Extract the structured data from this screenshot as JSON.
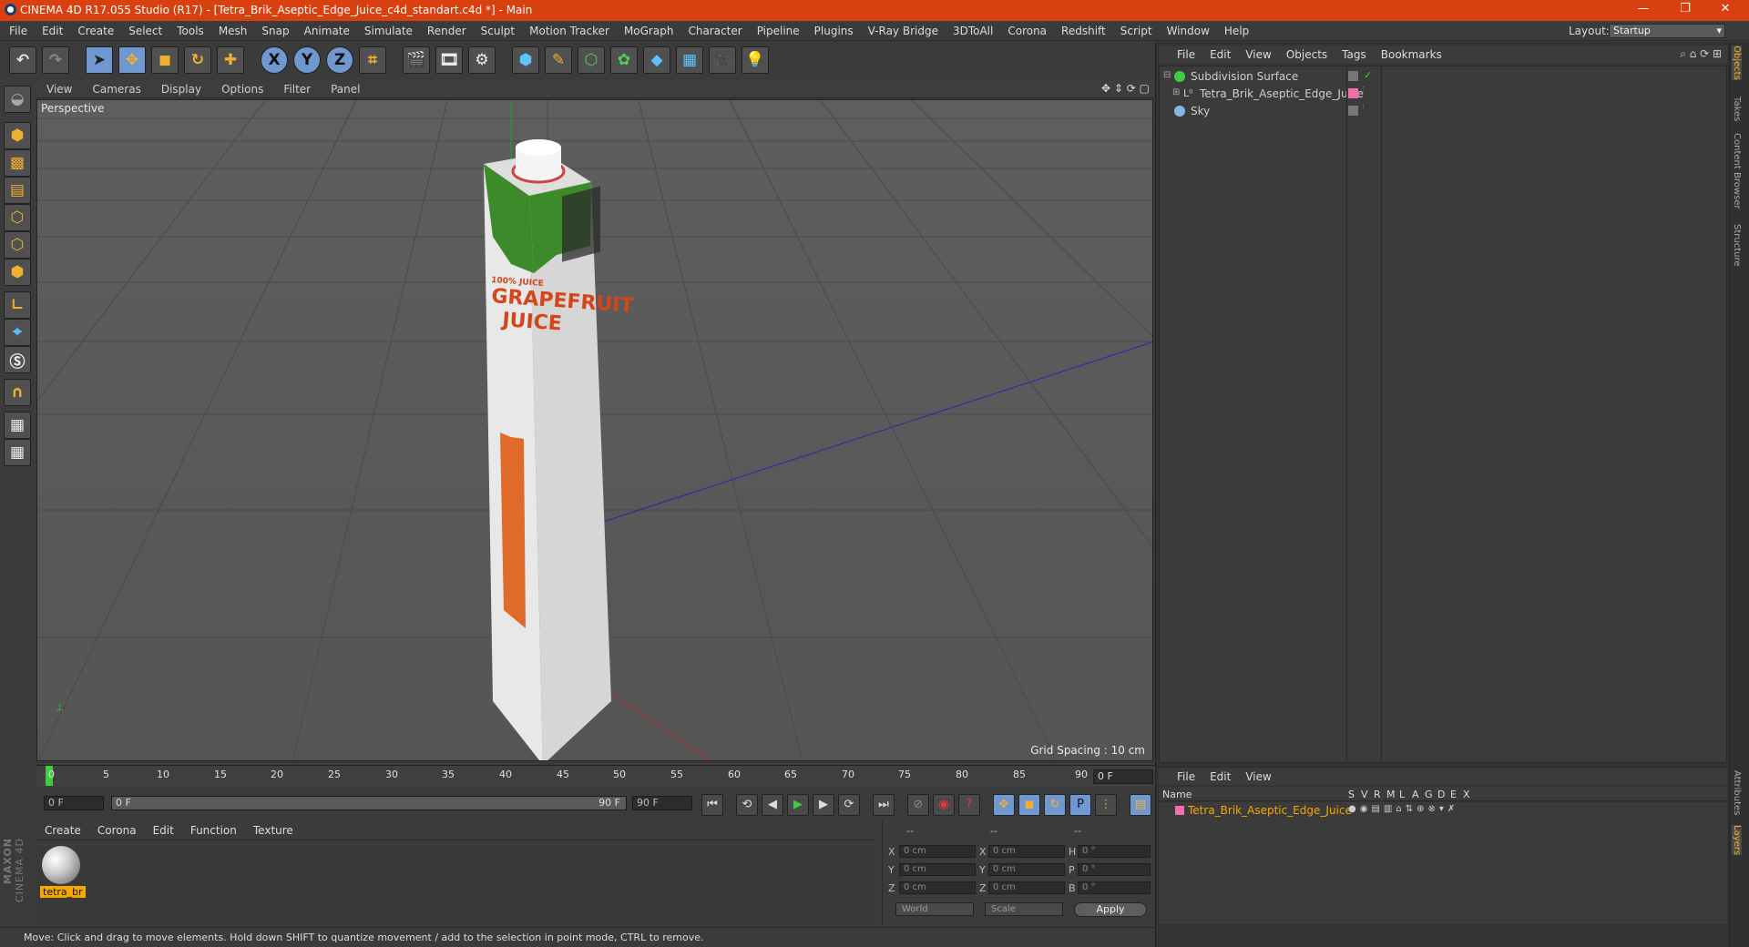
{
  "titlebar": {
    "title": "CINEMA 4D R17.055 Studio (R17) - [Tetra_Brik_Aseptic_Edge_Juice_c4d_standart.c4d *] - Main",
    "minimize": "—",
    "restore": "❐",
    "close": "✕"
  },
  "menubar": {
    "items": [
      "File",
      "Edit",
      "Create",
      "Select",
      "Tools",
      "Mesh",
      "Snap",
      "Animate",
      "Simulate",
      "Render",
      "Sculpt",
      "Motion Tracker",
      "MoGraph",
      "Character",
      "Pipeline",
      "Plugins",
      "V-Ray Bridge",
      "3DToAll",
      "Corona",
      "Redshift",
      "Script",
      "Window",
      "Help"
    ],
    "layout_label": "Layout:",
    "layout_value": "Startup"
  },
  "toolbar": {
    "axis_x": "X",
    "axis_y": "Y",
    "axis_z": "Z"
  },
  "viewport": {
    "menu": [
      "View",
      "Cameras",
      "Display",
      "Options",
      "Filter",
      "Panel"
    ],
    "label": "Perspective",
    "grid_spacing": "Grid Spacing : 10 cm",
    "product": {
      "text_top": "100% JUICE",
      "text_main_1": "GRAPEFRUIT",
      "text_main_2": "JUICE",
      "colors": {
        "leaf": "#3d8a2b",
        "juice": "#e06a2a",
        "carton": "#ececec",
        "lettering": "#d4451c"
      }
    }
  },
  "timeline": {
    "ticks": [
      "0",
      "5",
      "10",
      "15",
      "20",
      "25",
      "30",
      "35",
      "40",
      "45",
      "50",
      "55",
      "60",
      "65",
      "70",
      "75",
      "80",
      "85",
      "90"
    ],
    "current_frame": "0 F",
    "start_field": "0 F",
    "range_start": "0 F",
    "range_end": "90 F",
    "end_field": "90 F"
  },
  "materials": {
    "menu": [
      "Create",
      "Corona",
      "Edit",
      "Function",
      "Texture"
    ],
    "items": [
      {
        "name": "tetra_br"
      }
    ]
  },
  "coords": {
    "headers": [
      "--",
      "--",
      "--"
    ],
    "rows": [
      {
        "a": "X",
        "v1": "0 cm",
        "b": "X",
        "v2": "0 cm",
        "c": "H",
        "v3": "0 °"
      },
      {
        "a": "Y",
        "v1": "0 cm",
        "b": "Y",
        "v2": "0 cm",
        "c": "P",
        "v3": "0 °"
      },
      {
        "a": "Z",
        "v1": "0 cm",
        "b": "Z",
        "v2": "0 cm",
        "c": "B",
        "v3": "0 °"
      }
    ],
    "world": "World",
    "scale": "Scale",
    "apply": "Apply"
  },
  "statusbar": {
    "text": "Move: Click and drag to move elements. Hold down SHIFT to quantize movement / add to the selection in point mode, CTRL to remove."
  },
  "branding": {
    "maxon": "MAXON",
    "cinema": "CINEMA 4D"
  },
  "objects": {
    "menu": [
      "File",
      "Edit",
      "View",
      "Objects",
      "Tags",
      "Bookmarks"
    ],
    "items": [
      {
        "name": "Subdivision Surface",
        "color": "#cfcfcf"
      },
      {
        "name": "Tetra_Brik_Aseptic_Edge_Juice",
        "color": "#cfcfcf"
      },
      {
        "name": "Sky",
        "color": "#cfcfcf"
      }
    ]
  },
  "layers": {
    "menu": [
      "File",
      "Edit",
      "View"
    ],
    "col_name": "Name",
    "cols": [
      "S",
      "V",
      "R",
      "M",
      "L",
      "A",
      "G",
      "D",
      "E",
      "X"
    ],
    "row_name": "Tetra_Brik_Aseptic_Edge_Juice",
    "row_color": "#f5a800"
  },
  "sidetabs": [
    "Objects",
    "Takes",
    "Content Browser",
    "Structure",
    "Attributes",
    "Layers"
  ]
}
